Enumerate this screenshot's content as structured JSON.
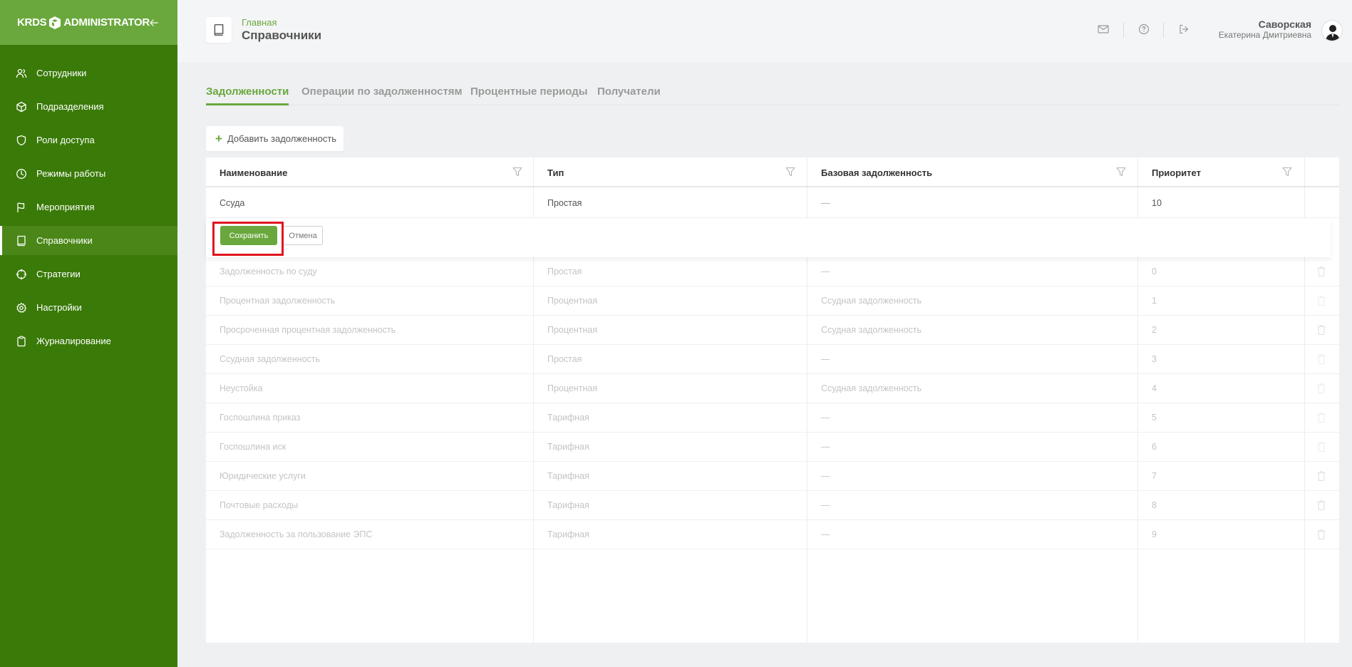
{
  "app": {
    "logo_left": "KRDS",
    "logo_right": "ADMINISTRATOR"
  },
  "sidebar": {
    "items": [
      {
        "label": "Сотрудники",
        "icon": "users-icon"
      },
      {
        "label": "Подразделения",
        "icon": "cube-icon"
      },
      {
        "label": "Роли доступа",
        "icon": "shield-icon"
      },
      {
        "label": "Режимы работы",
        "icon": "clock-icon"
      },
      {
        "label": "Мероприятия",
        "icon": "flag-icon"
      },
      {
        "label": "Справочники",
        "icon": "book-icon",
        "active": true
      },
      {
        "label": "Стратегии",
        "icon": "crosshair-icon"
      },
      {
        "label": "Настройки",
        "icon": "gear-icon"
      },
      {
        "label": "Журналирование",
        "icon": "clipboard-icon"
      }
    ]
  },
  "header": {
    "breadcrumb": "Главная",
    "title": "Справочники",
    "user_last_name": "Саворская",
    "user_first_name": "Екатерина Дмитриевна"
  },
  "tabs": [
    "Задолженности",
    "Операции по задолженностям",
    "Процентные периоды",
    "Получатели"
  ],
  "add_button": "Добавить задолженность",
  "table": {
    "columns": [
      "Наименование",
      "Тип",
      "Базовая задолженность",
      "Приоритет"
    ],
    "editing_row": {
      "name": "Ссуда",
      "type": "Простая",
      "base": "—",
      "priority": "10"
    },
    "save_label": "Сохранить",
    "cancel_label": "Отмена",
    "rows": [
      {
        "name": "Задолженность по суду",
        "type": "Простая",
        "base": "—",
        "priority": "0"
      },
      {
        "name": "Процентная задолженность",
        "type": "Процентная",
        "base": "Ссудная задолженность",
        "priority": "1"
      },
      {
        "name": "Просроченная процентная задолженность",
        "type": "Процентная",
        "base": "Ссудная задолженность",
        "priority": "2"
      },
      {
        "name": "Ссудная задолженность",
        "type": "Простая",
        "base": "—",
        "priority": "3"
      },
      {
        "name": "Неустойка",
        "type": "Процентная",
        "base": "Ссудная задолженность",
        "priority": "4"
      },
      {
        "name": "Госпошлина приказ",
        "type": "Тарифная",
        "base": "—",
        "priority": "5"
      },
      {
        "name": "Госпошлина иск",
        "type": "Тарифная",
        "base": "—",
        "priority": "6"
      },
      {
        "name": "Юридические услуги",
        "type": "Тарифная",
        "base": "—",
        "priority": "7"
      },
      {
        "name": "Почтовые расходы",
        "type": "Тарифная",
        "base": "—",
        "priority": "8"
      },
      {
        "name": "Задолженность за пользование ЭПС",
        "type": "Тарифная",
        "base": "—",
        "priority": "9"
      }
    ]
  },
  "colors": {
    "sidebar": "#3a7a08",
    "accent": "#6aa83d",
    "highlight": "#e0141e"
  }
}
